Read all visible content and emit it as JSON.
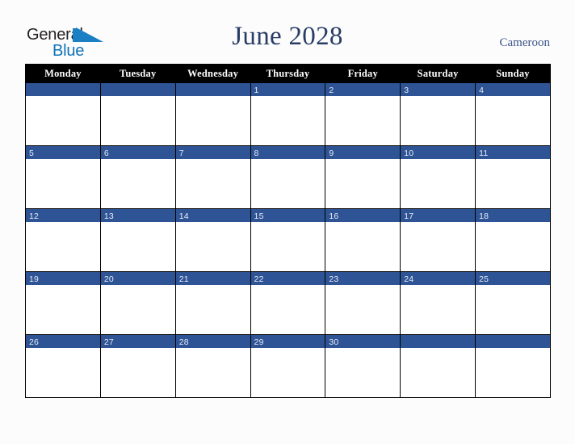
{
  "brand": {
    "name_part1": "General",
    "name_part2": "Blue",
    "triangle_icon": "blue-triangle-icon",
    "color_dark": "#231f20",
    "color_blue": "#1072b8"
  },
  "header": {
    "title": "June 2028",
    "country": "Cameroon",
    "title_color": "#283c64",
    "country_color": "#3b5488"
  },
  "calendar": {
    "header_bg": "#000000",
    "header_text_color": "#ffffff",
    "daybar_bg": "#2e5496",
    "daynum_color": "#e8ecf4",
    "cell_bg": "#ffffff",
    "border_color": "#000000",
    "weekdays": [
      "Monday",
      "Tuesday",
      "Wednesday",
      "Thursday",
      "Friday",
      "Saturday",
      "Sunday"
    ],
    "weeks": [
      [
        "",
        "",
        "",
        "1",
        "2",
        "3",
        "4"
      ],
      [
        "5",
        "6",
        "7",
        "8",
        "9",
        "10",
        "11"
      ],
      [
        "12",
        "13",
        "14",
        "15",
        "16",
        "17",
        "18"
      ],
      [
        "19",
        "20",
        "21",
        "22",
        "23",
        "24",
        "25"
      ],
      [
        "26",
        "27",
        "28",
        "29",
        "30",
        "",
        ""
      ]
    ]
  }
}
